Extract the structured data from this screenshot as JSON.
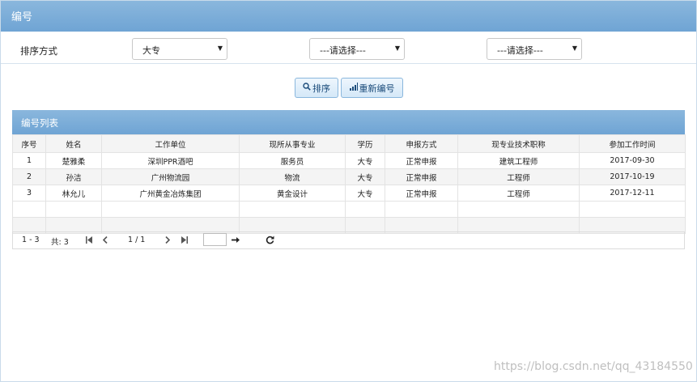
{
  "header": {
    "title": "编号"
  },
  "filter": {
    "sort_label": "排序方式",
    "select1": "大专",
    "select2": "---请选择---",
    "select3": "---请选择---"
  },
  "buttons": {
    "sort": "排序",
    "renumber": "重新编号"
  },
  "panel": {
    "title": "编号列表"
  },
  "table": {
    "columns": [
      "序号",
      "姓名",
      "工作单位",
      "现所从事专业",
      "学历",
      "申报方式",
      "现专业技术职称",
      "参加工作时间"
    ],
    "rows": [
      [
        "1",
        "楚雅柔",
        "深圳PPR酒吧",
        "服务员",
        "大专",
        "正常申报",
        "建筑工程师",
        "2017-09-30"
      ],
      [
        "2",
        "孙洁",
        "广州物流园",
        "物流",
        "大专",
        "正常申报",
        "工程师",
        "2017-10-19"
      ],
      [
        "3",
        "林允儿",
        "广州黄金冶炼集团",
        "黄金设计",
        "大专",
        "正常申报",
        "工程师",
        "2017-12-11"
      ]
    ]
  },
  "pager": {
    "range": "1 - 3",
    "total": "共: 3",
    "pages": "1 / 1"
  },
  "watermark": "https://blog.csdn.net/qq_43184550"
}
